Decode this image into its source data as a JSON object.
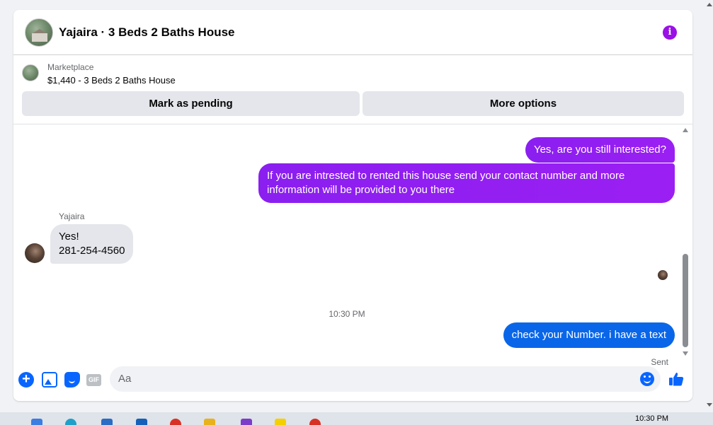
{
  "header": {
    "title": "Yajaira · 3 Beds 2 Baths House",
    "avatar_icon": "listing-photo",
    "info_icon": "info-icon",
    "accent_color": "#9a10e6"
  },
  "listing": {
    "source": "Marketplace",
    "price_title": "$1,440 - 3 Beds 2 Baths House",
    "buttons": {
      "mark_pending": "Mark as pending",
      "more_options": "More options"
    }
  },
  "messages": [
    {
      "direction": "outgoing",
      "text": "Yes, are you still interested?"
    },
    {
      "direction": "outgoing",
      "text": "If you are intrested to rented this house send your contact number and more information will be provided to you there"
    },
    {
      "direction": "incoming",
      "sender": "Yajaira",
      "lines": [
        "Yes!",
        "281-254-4560"
      ]
    },
    {
      "direction": "outgoing",
      "text": "check your Number. i have a text",
      "status": "Sent"
    }
  ],
  "thread": {
    "time_separator": "10:30 PM",
    "incoming_sender": "Yajaira"
  },
  "composer": {
    "placeholder": "Aa",
    "icons": [
      "plus-icon",
      "photo-icon",
      "sticker-icon",
      "gif-icon",
      "emoji-icon",
      "like-icon"
    ],
    "gif_label": "GIF"
  },
  "taskbar": {
    "time": "10:30 PM"
  },
  "colors": {
    "outgoing_bubble": "#9b1ff2",
    "last_bubble": "#0a66e8",
    "incoming_bubble": "#e4e6eb",
    "composer_icons": "#0866ff"
  }
}
